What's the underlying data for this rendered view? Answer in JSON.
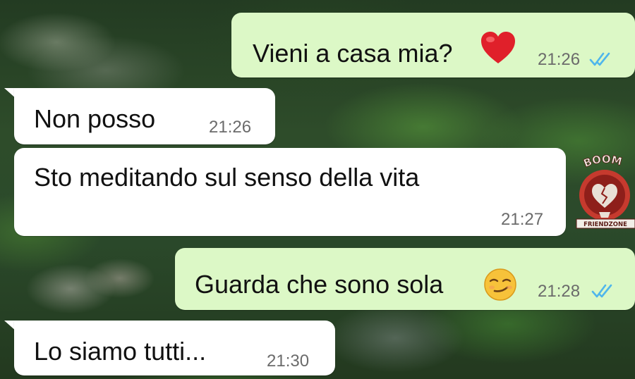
{
  "messages": [
    {
      "direction": "sent",
      "text": "Vieni a casa mia?",
      "emoji": "red-heart",
      "time": "21:26",
      "status": "read"
    },
    {
      "direction": "received",
      "text": "Non posso",
      "time": "21:26"
    },
    {
      "direction": "received",
      "text": "Sto meditando sul senso della vita",
      "time": "21:27"
    },
    {
      "direction": "sent",
      "text": "Guarda che sono sola",
      "emoji": "smirking-face",
      "time": "21:28",
      "status": "read"
    },
    {
      "direction": "received",
      "text": "Lo siamo tutti...",
      "time": "21:30"
    }
  ],
  "watermark": {
    "top_text": "BOOM",
    "bottom_text": "FRIENDZONE"
  },
  "colors": {
    "sent_bubble": "#dcf8c6",
    "received_bubble": "#ffffff",
    "read_ticks": "#4fb6ec",
    "heart": "#e0202a"
  }
}
